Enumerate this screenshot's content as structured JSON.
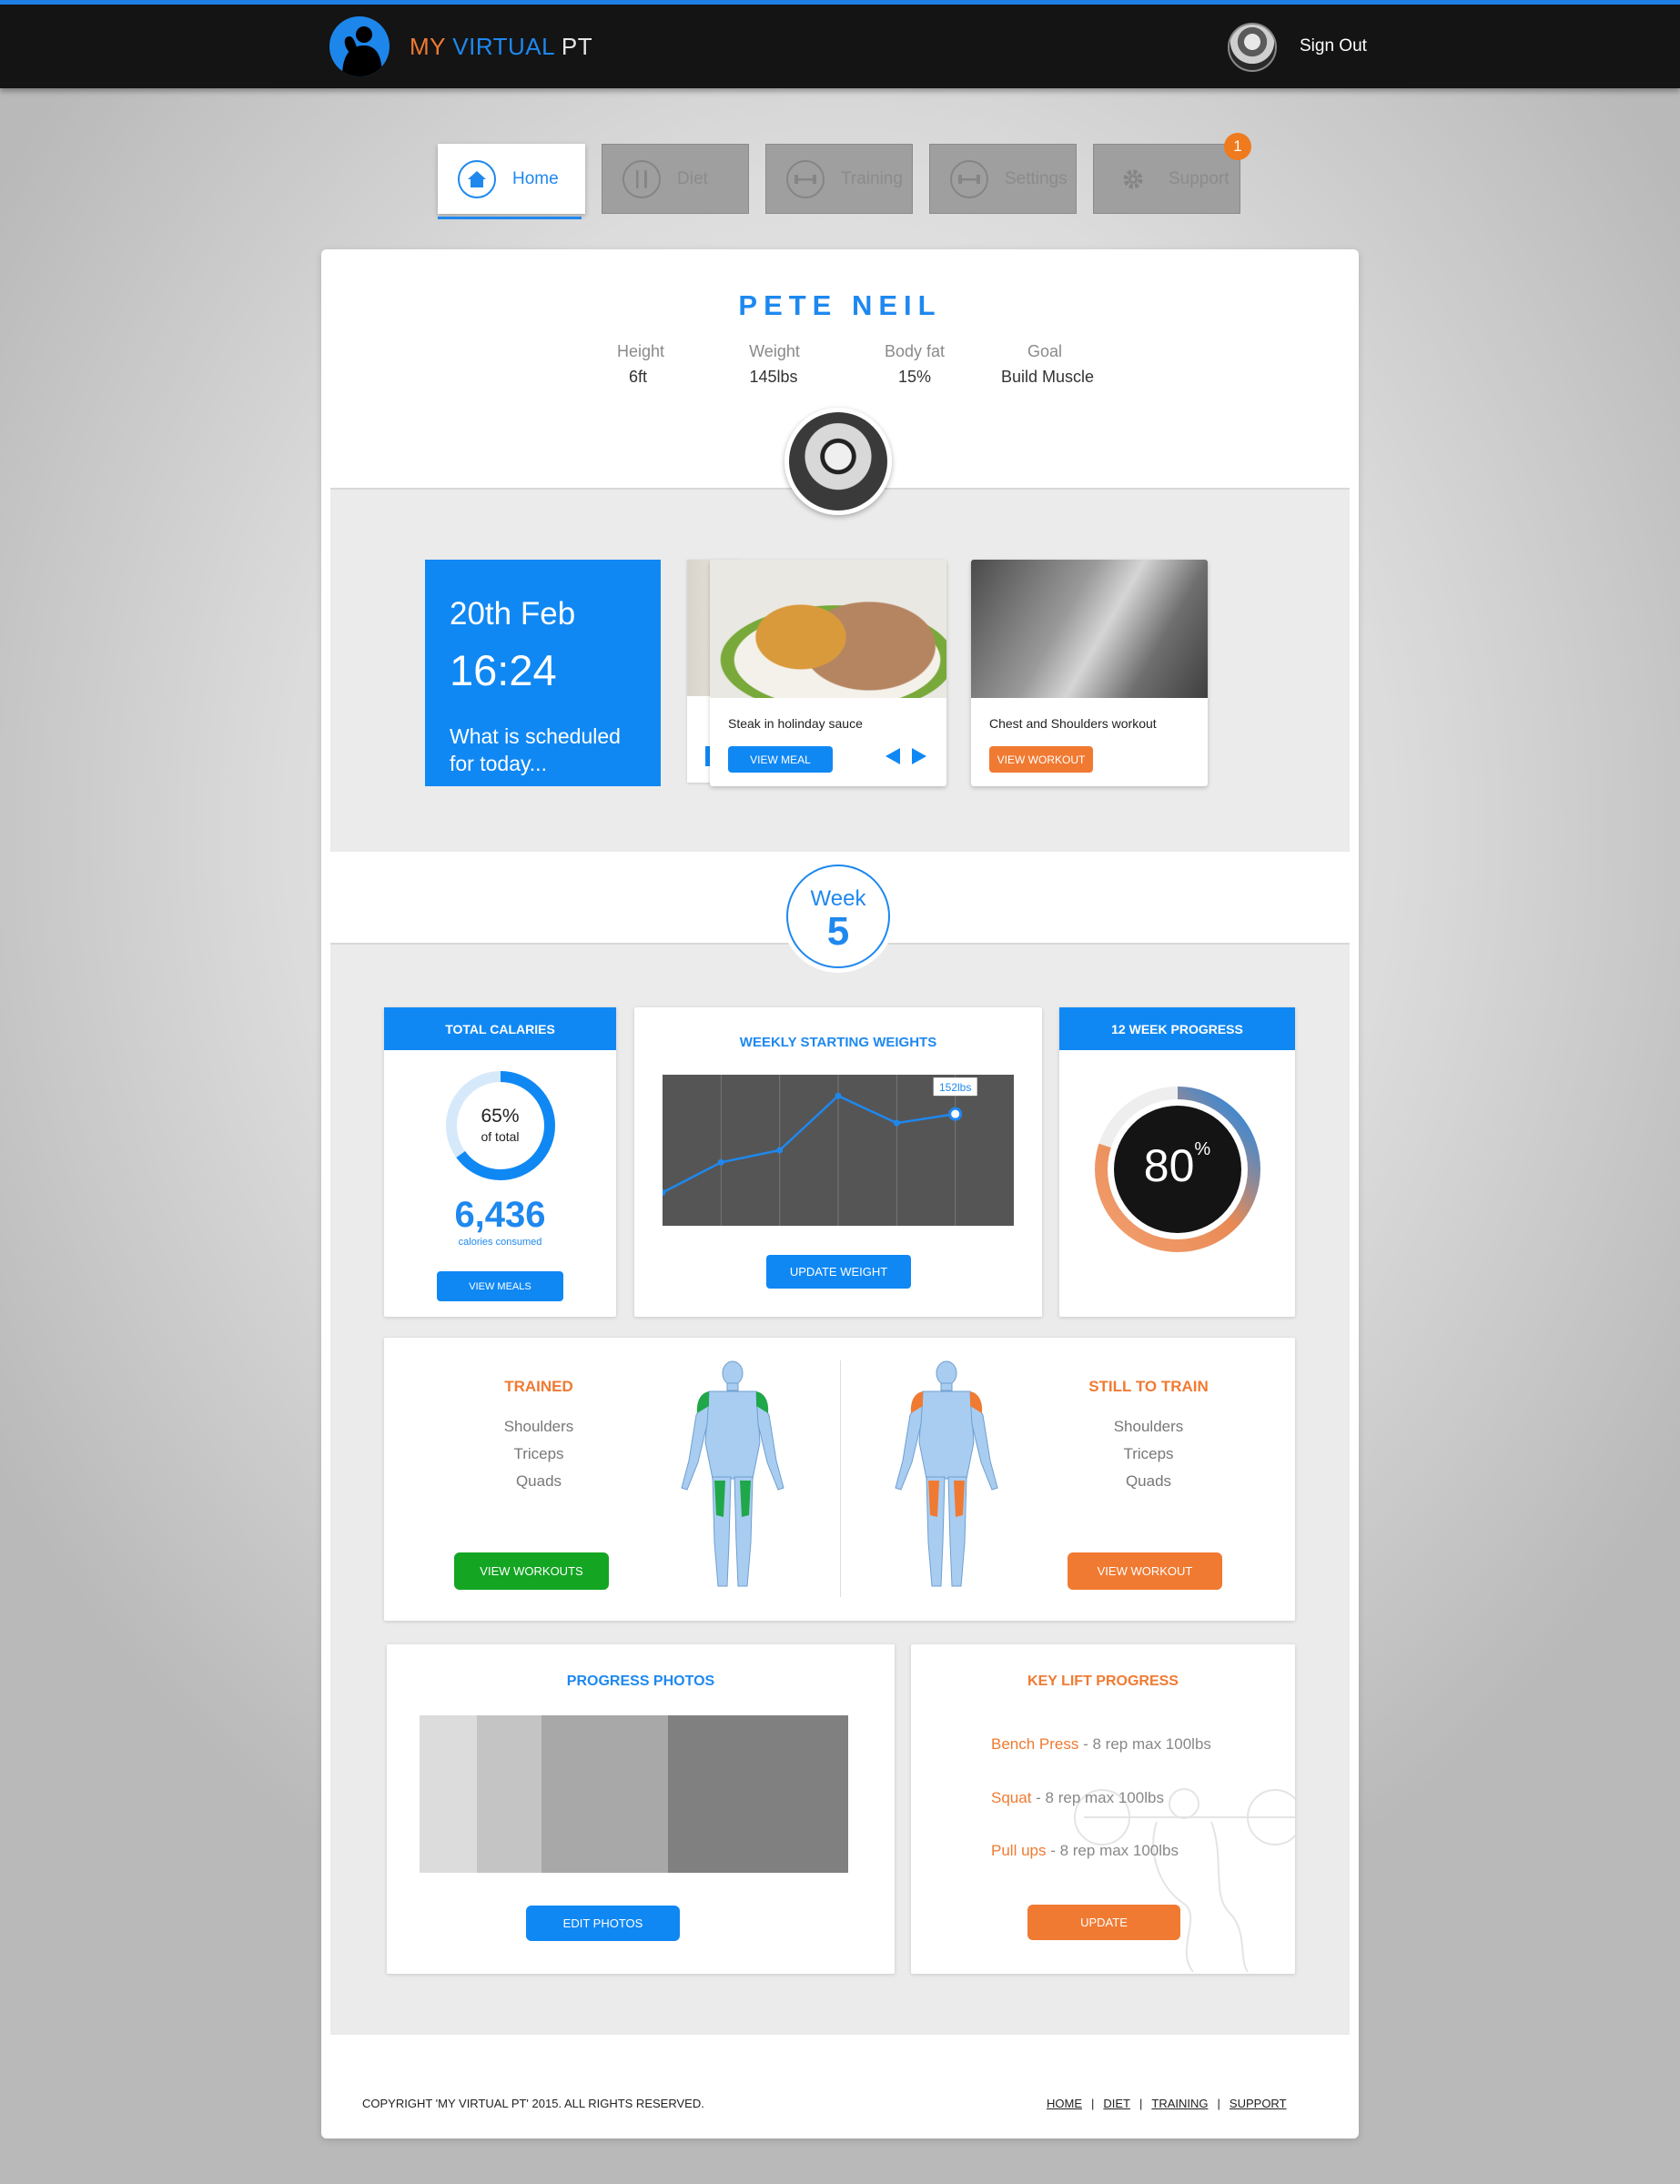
{
  "header": {
    "brand_my": "MY",
    "brand_virtual": "VIRTUAL",
    "brand_pt": "PT",
    "sign_out": "Sign Out"
  },
  "nav": {
    "tabs": [
      {
        "label": "Home",
        "icon": "home-icon",
        "active": true
      },
      {
        "label": "Diet",
        "icon": "fork-knife-icon"
      },
      {
        "label": "Training",
        "icon": "dumbbell-icon"
      },
      {
        "label": "Settings",
        "icon": "dumbbell-icon"
      },
      {
        "label": "Support",
        "icon": "gear-icon"
      }
    ],
    "support_badge": "1"
  },
  "profile": {
    "name": "PETE NEIL",
    "stats": [
      {
        "label": "Height",
        "value": "6ft"
      },
      {
        "label": "Weight",
        "value": "145lbs"
      },
      {
        "label": "Body fat",
        "value": "15%"
      },
      {
        "label": "Goal",
        "value": "Build Muscle"
      }
    ]
  },
  "schedule": {
    "date": "20th Feb",
    "time": "16:24",
    "prompt": "What is scheduled for today...",
    "meal": {
      "caption": "Steak in holinday sauce",
      "button": "VIEW MEAL"
    },
    "workout": {
      "caption": "Chest and Shoulders workout",
      "button": "VIEW WORKOUT"
    }
  },
  "week": {
    "label": "Week",
    "number": "5"
  },
  "calories": {
    "header": "TOTAL CALARIES",
    "percent_text": "65%",
    "percent_sub": "of total",
    "percent": 65,
    "total": "6,436",
    "total_sub": "calories consumed",
    "button": "VIEW MEALS"
  },
  "chart_data": {
    "type": "line",
    "title": "WEEKLY STARTING WEIGHTS",
    "x": [
      0,
      1,
      2,
      3,
      4,
      5
    ],
    "values": [
      126,
      136,
      140,
      158,
      149,
      152
    ],
    "ylim": [
      115,
      165
    ],
    "xlim": [
      0,
      6
    ],
    "annotation": {
      "index": 5,
      "text": "152lbs"
    },
    "grid": "vertical",
    "button": "UPDATE WEIGHT"
  },
  "progress12": {
    "header": "12 WEEK PROGRESS",
    "value": "80",
    "unit": "%",
    "percent": 80
  },
  "muscles": {
    "trained_title": "TRAINED",
    "trained": [
      "Shoulders",
      "Triceps",
      "Quads"
    ],
    "trained_button": "VIEW WORKOUTS",
    "still_title": "STILL TO TRAIN",
    "still": [
      "Shoulders",
      "Triceps",
      "Quads"
    ],
    "still_button": "VIEW WORKOUT"
  },
  "photos": {
    "title": "PROGRESS PHOTOS",
    "button": "EDIT PHOTOS"
  },
  "lifts": {
    "title": "KEY LIFT PROGRESS",
    "items": [
      {
        "name": "Bench Press",
        "detail": " - 8 rep max 100lbs"
      },
      {
        "name": "Squat",
        "detail": " - 8 rep max 100lbs"
      },
      {
        "name": "Pull ups",
        "detail": " - 8 rep max 100lbs"
      }
    ],
    "button": "UPDATE"
  },
  "footer": {
    "copyright": "COPYRIGHT 'MY VIRTUAL PT' 2015. ALL RIGHTS RESERVED.",
    "links": [
      "HOME",
      "DIET",
      "TRAINING",
      "SUPPORT"
    ],
    "sep": "|"
  },
  "colors": {
    "accent": "#1088f4",
    "orange": "#f07a32",
    "green": "#14a523",
    "dark": "#141414"
  }
}
